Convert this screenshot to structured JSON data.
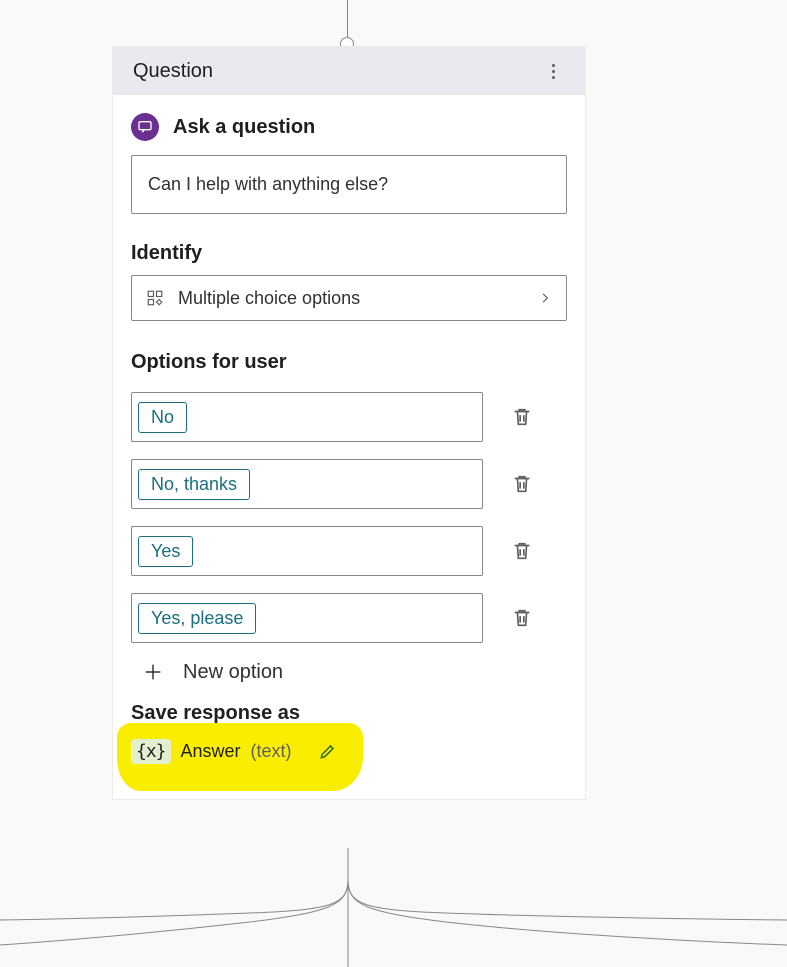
{
  "header": {
    "title": "Question"
  },
  "ask": {
    "label": "Ask a question",
    "question_text": "Can I help with anything else?"
  },
  "identify": {
    "label": "Identify",
    "value": "Multiple choice options"
  },
  "options": {
    "label": "Options for user",
    "items": [
      {
        "text": "No"
      },
      {
        "text": "No, thanks"
      },
      {
        "text": "Yes"
      },
      {
        "text": "Yes, please"
      }
    ],
    "new_option_label": "New option"
  },
  "save": {
    "label": "Save response as",
    "var_icon": "{x}",
    "var_name": "Answer",
    "var_type": "(text)"
  }
}
